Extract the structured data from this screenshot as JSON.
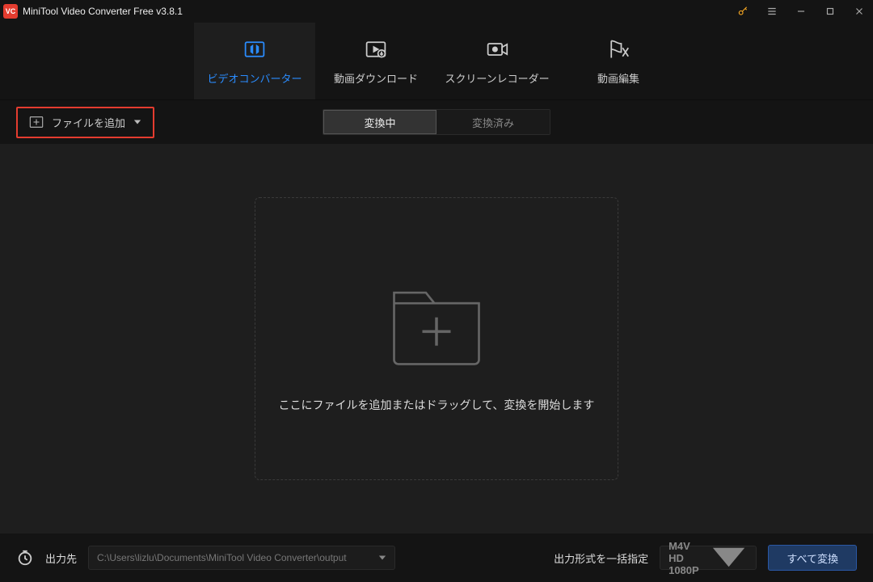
{
  "titlebar": {
    "title": "MiniTool Video Converter Free v3.8.1"
  },
  "nav": {
    "tabs": [
      {
        "id": "video-converter",
        "label": "ビデオコンバーター",
        "active": true
      },
      {
        "id": "video-download",
        "label": "動画ダウンロード",
        "active": false
      },
      {
        "id": "screen-recorder",
        "label": "スクリーンレコーダー",
        "active": false
      },
      {
        "id": "video-edit",
        "label": "動画編集",
        "active": false
      }
    ]
  },
  "toolbar": {
    "add_file_label": "ファイルを追加",
    "status_tabs": [
      {
        "id": "converting",
        "label": "変換中",
        "active": true
      },
      {
        "id": "converted",
        "label": "変換済み",
        "active": false
      }
    ]
  },
  "main": {
    "drop_hint": "ここにファイルを追加またはドラッグして、変換を開始します"
  },
  "footer": {
    "output_dest_label": "出力先",
    "output_path": "C:\\Users\\lizlu\\Documents\\MiniTool Video Converter\\output",
    "output_format_label": "出力形式を一括指定",
    "output_format_value": "M4V HD 1080P",
    "convert_all_label": "すべて変換"
  },
  "colors": {
    "accent_blue": "#2a8cff",
    "accent_red": "#e43c2f",
    "key_gold": "#f5a623",
    "bg_dark": "#141414",
    "bg_main": "#1e1e1e"
  }
}
